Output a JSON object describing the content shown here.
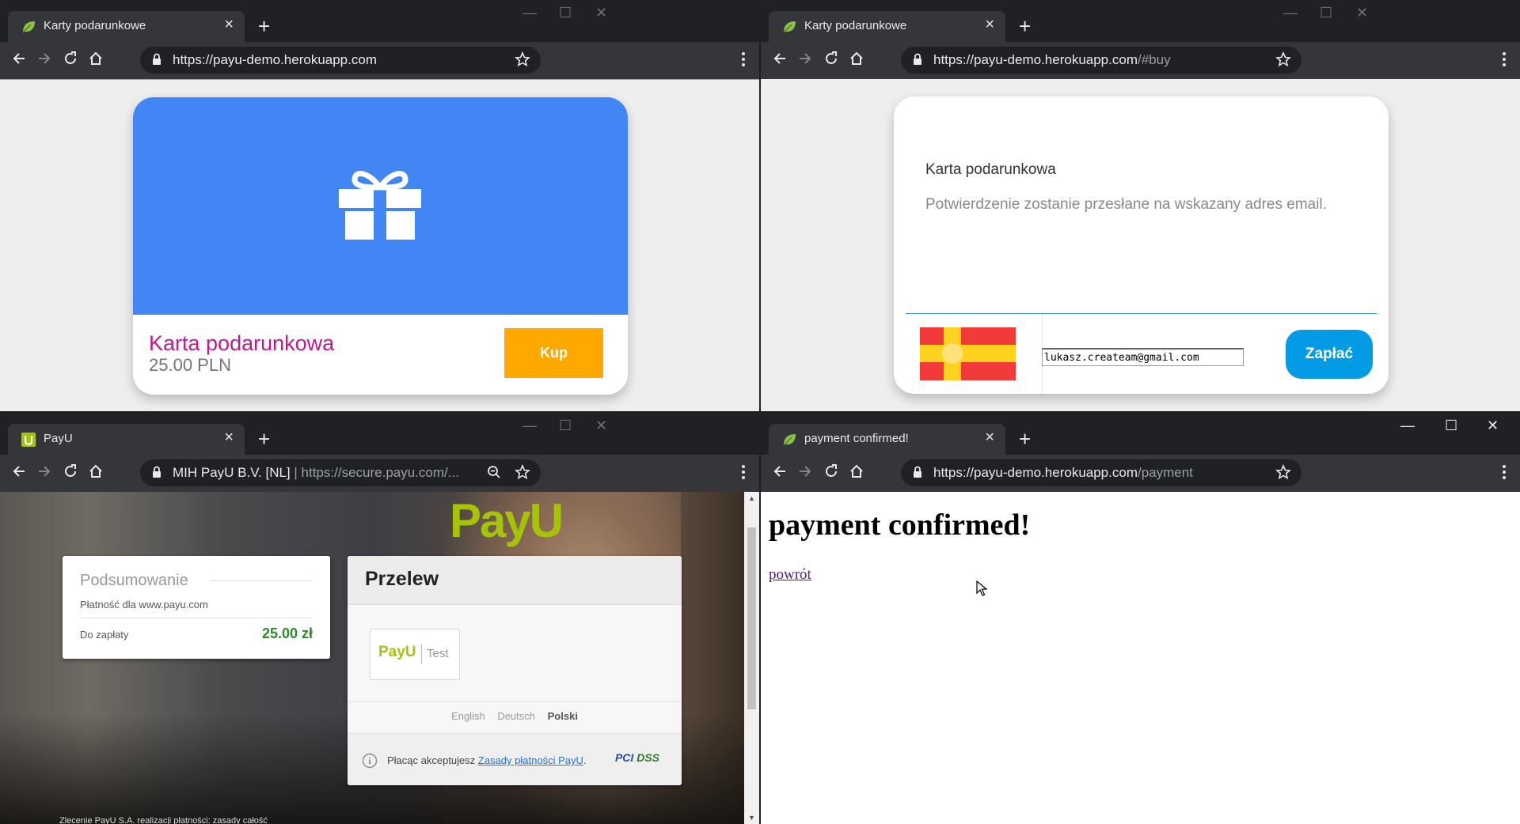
{
  "windows": {
    "giftcard": {
      "tab_title": "Karty podarunkowe",
      "url_host": "https://payu-demo.herokuapp.com",
      "url_path": "",
      "card_title": "Karta podarunkowa",
      "card_price": "25.00 PLN",
      "buy_label": "Kup",
      "colors": {
        "card_header": "#4285f4",
        "title": "#c2188a",
        "buy": "#ffa900"
      }
    },
    "buy": {
      "tab_title": "Karty podarunkowe",
      "url_host": "https://payu-demo.herokuapp.com",
      "url_path": "/#buy",
      "card_title": "Karta podarunkowa",
      "card_subtitle": "Potwierdzenie zostanie przesłane na wskazany adres email.",
      "email_value": "lukasz.createam@gmail.com",
      "pay_label": "Zapłać",
      "colors": {
        "pay": "#039be5"
      }
    },
    "payu": {
      "tab_title": "PayU",
      "url_cert": "MIH PayU B.V. [NL]",
      "url_sep": "|",
      "url": "https://secure.payu.com/...",
      "logo": "PayU",
      "summary_heading": "Podsumowanie",
      "payment_for": "Płatność dla www.payu.com",
      "to_pay_label": "Do zapłaty",
      "to_pay_amount": "25.00 zł",
      "transfer_heading": "Przelew",
      "method_logo": "PayU",
      "method_label": "Test",
      "languages": [
        "English",
        "Deutsch",
        "Polski"
      ],
      "active_language": "Polski",
      "terms_prefix": "Płacąc akceptujesz ",
      "terms_link": "Zasady płatności PayU",
      "terms_suffix": ".",
      "pci_logo": "PCI",
      "pci_suffix": "DSS",
      "bottom_text": "Zlecenie PayU S.A. realizacji płatności: zasady całość"
    },
    "confirmed": {
      "tab_title": "payment confirmed!",
      "url_host": "https://payu-demo.herokuapp.com",
      "url_path": "/payment",
      "heading": "payment confirmed!",
      "back_link": "powrót"
    }
  }
}
